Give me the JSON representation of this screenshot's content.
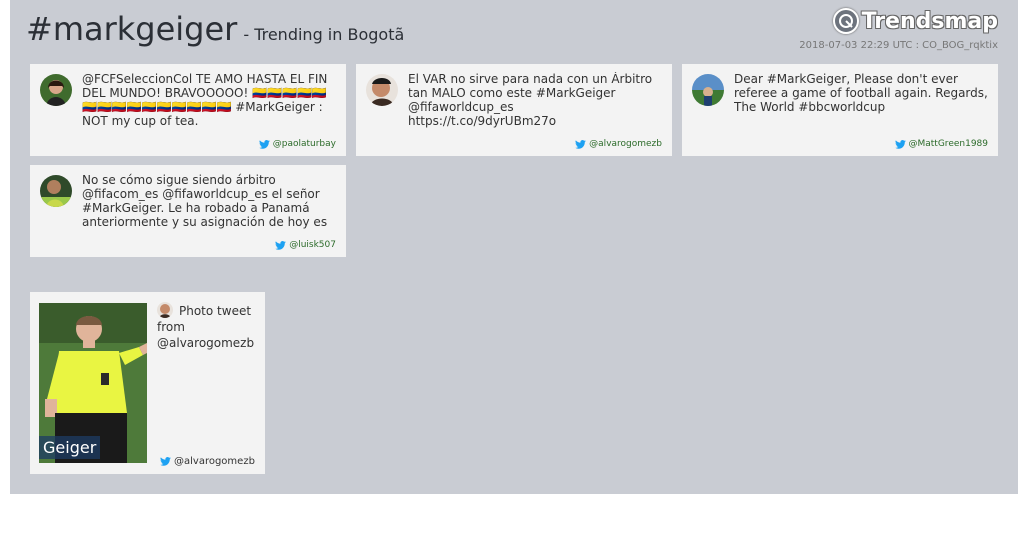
{
  "header": {
    "hashtag": "#markgeiger",
    "trending": "- Trending in Bogotã",
    "brand": "Trendsmap",
    "meta": "2018-07-03 22:29 UTC : CO_BOG_rqktix"
  },
  "tweets": [
    {
      "text": "@FCFSeleccionCol TE AMO HASTA EL FIN DEL MUNDO! BRAVOOOOO! 🇨🇴🇨🇴🇨🇴🇨🇴🇨🇴🇨🇴🇨🇴🇨🇴🇨🇴🇨🇴🇨🇴🇨🇴🇨🇴🇨🇴🇨🇴 #MarkGeiger : NOT my cup of tea.",
      "author": "@paolaturbay"
    },
    {
      "text": "El VAR no sirve para nada con un Árbitro tan MALO como este #MarkGeiger @fifaworldcup_es https://t.co/9dyrUBm27o",
      "author": "@alvarogomezb"
    },
    {
      "text": "Dear #MarkGeiger, Please don't ever referee a game of football again. Regards, The World #bbcworldcup",
      "author": "@MattGreen1989"
    },
    {
      "text": "No se cómo sigue siendo árbitro @fifacom_es @fifaworldcup_es el señor #MarkGeiger. Le ha robado a Panamá anteriormente y su asignación de hoy es",
      "author": "@luisk507"
    }
  ],
  "photo_tweet": {
    "caption": "Photo tweet from @alvarogomezb",
    "author": "@alvarogomezb",
    "overlay": "Geiger"
  },
  "colors": {
    "panel": "#c9ccd3",
    "card": "#f3f3f3",
    "twitter_blue": "#1da1f2"
  }
}
